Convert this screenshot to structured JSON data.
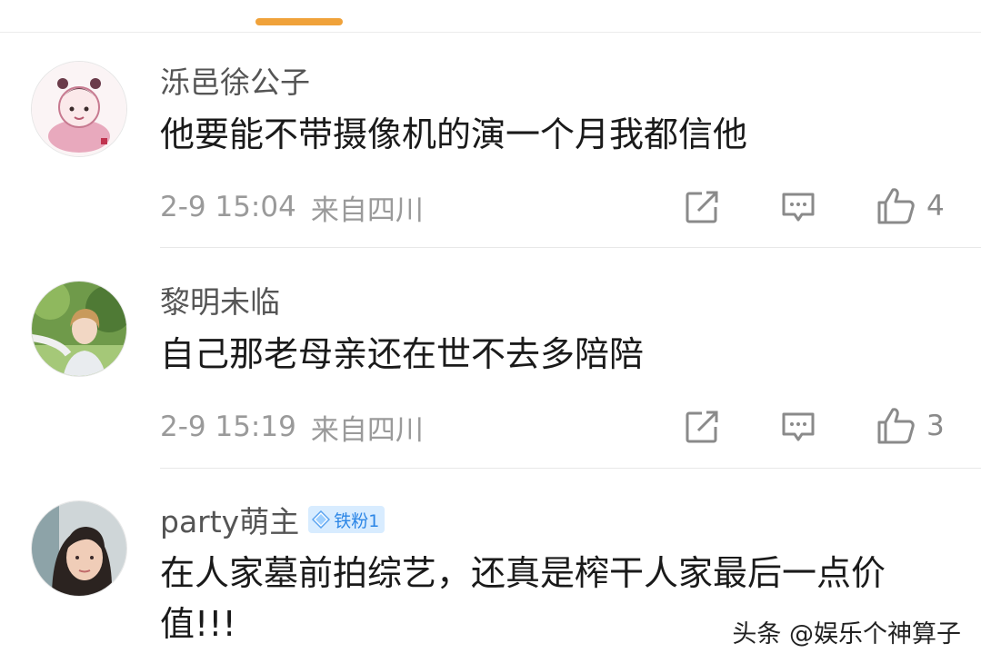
{
  "comments": [
    {
      "username": "泺邑徐公子",
      "text": "他要能不带摄像机的演一个月我都信他",
      "time": "2-9 15:04",
      "location": "来自四川",
      "likes": "4"
    },
    {
      "username": "黎明未临",
      "text": "自己那老母亲还在世不去多陪陪",
      "time": "2-9 15:19",
      "location": "来自四川",
      "likes": "3"
    },
    {
      "username": "party萌主",
      "badge": "铁粉1",
      "text": "在人家墓前拍综艺，还真是榨干人家最后一点价值!!!"
    }
  ],
  "watermark": "头条 @娱乐个神算子",
  "icons": {
    "share": "share-icon",
    "comment": "comment-icon",
    "like": "thumbs-up-icon",
    "badge": "diamond-icon"
  },
  "colors": {
    "tab_indicator": "#f0a23a",
    "badge_bg": "#d8ecff",
    "badge_text": "#2c86e6"
  }
}
